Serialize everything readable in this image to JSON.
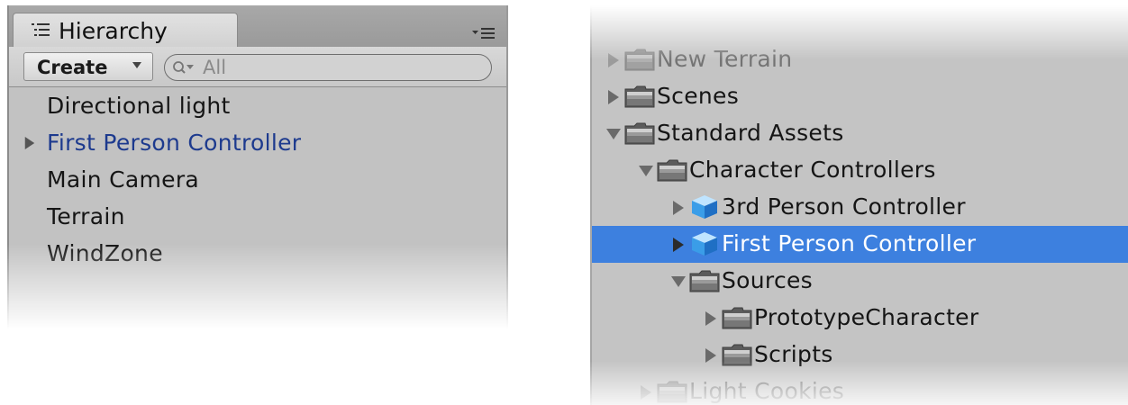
{
  "hierarchy": {
    "tab_title": "Hierarchy",
    "tab_icon": "list-icon",
    "menu_icon": "panel-menu-icon",
    "create_label": "Create",
    "search_placeholder": "All",
    "items": [
      {
        "label": "Directional light",
        "has_children": false,
        "prefab": false
      },
      {
        "label": "First Person Controller",
        "has_children": true,
        "prefab": true
      },
      {
        "label": "Main Camera",
        "has_children": false,
        "prefab": false
      },
      {
        "label": "Terrain",
        "has_children": false,
        "prefab": false
      },
      {
        "label": "WindZone",
        "has_children": false,
        "prefab": false
      }
    ]
  },
  "project": {
    "items": [
      {
        "label": "New Terrain",
        "depth": 0,
        "expanded": false,
        "icon": "folder-icon",
        "faded": true
      },
      {
        "label": "Scenes",
        "depth": 0,
        "expanded": false,
        "icon": "folder-icon"
      },
      {
        "label": "Standard Assets",
        "depth": 0,
        "expanded": true,
        "icon": "folder-icon"
      },
      {
        "label": "Character Controllers",
        "depth": 1,
        "expanded": true,
        "icon": "folder-icon"
      },
      {
        "label": "3rd Person Controller",
        "depth": 2,
        "expanded": false,
        "icon": "prefab-cube-icon"
      },
      {
        "label": "First Person Controller",
        "depth": 2,
        "expanded": false,
        "icon": "prefab-cube-icon",
        "selected": true
      },
      {
        "label": "Sources",
        "depth": 2,
        "expanded": true,
        "icon": "folder-icon"
      },
      {
        "label": "PrototypeCharacter",
        "depth": 3,
        "expanded": false,
        "icon": "folder-icon"
      },
      {
        "label": "Scripts",
        "depth": 3,
        "expanded": false,
        "icon": "folder-icon"
      },
      {
        "label": "Light Cookies",
        "depth": 1,
        "expanded": false,
        "icon": "folder-icon",
        "faded": true
      }
    ]
  },
  "colors": {
    "panel_bg": "#c2c2c2",
    "selection": "#3d80df",
    "prefab_text": "#1d3a8e"
  }
}
